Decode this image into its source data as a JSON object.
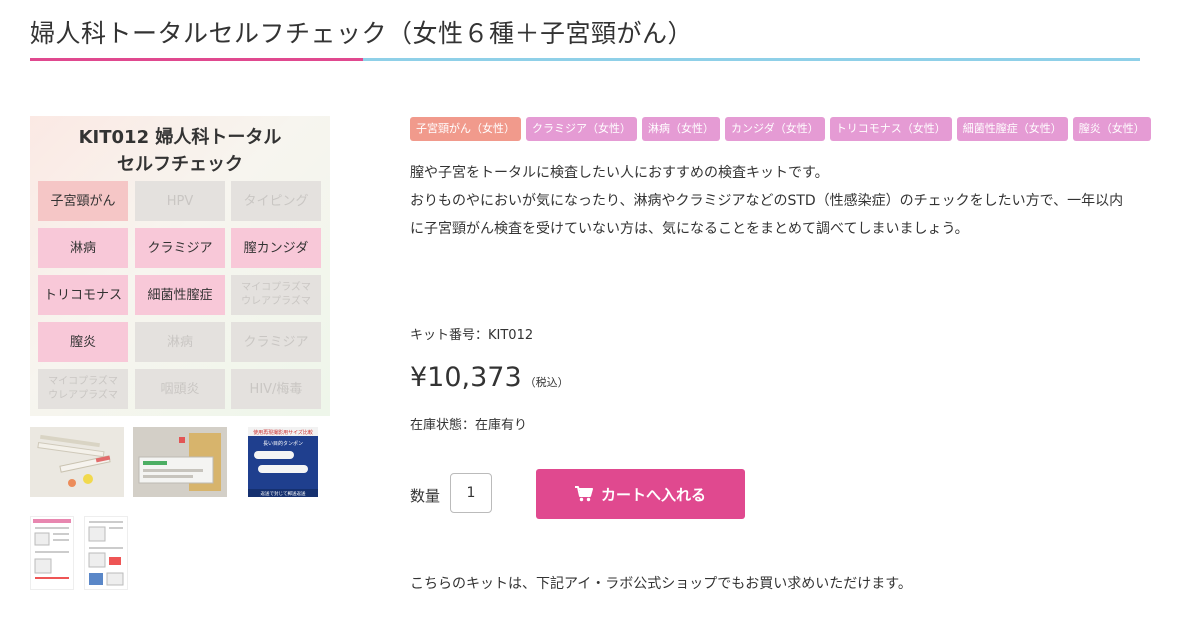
{
  "page_title": "婦人科トータルセルフチェック（女性６種＋子宮頸がん）",
  "main_image": {
    "heading_line1": "KIT012 婦人科トータル",
    "heading_line2": "セルフチェック",
    "grid": [
      [
        "子宮頸がん",
        "HPV",
        "タイピング"
      ],
      [
        "淋病",
        "クラミジア",
        "膣カンジダ"
      ],
      [
        "トリコモナス",
        "細菌性膣症",
        "マイコプラズマ\nウレアプラズマ"
      ],
      [
        "膣炎",
        "淋病",
        "クラミジア"
      ],
      [
        "マイコプラズマ\nウレアプラズマ",
        "咽頭炎",
        "HIV/梅毒"
      ]
    ]
  },
  "tags": [
    "子宮頸がん（女性）",
    "クラミジア（女性）",
    "淋病（女性）",
    "カンジダ（女性）",
    "トリコモナス（女性）",
    "細菌性膣症（女性）",
    "膣炎（女性）"
  ],
  "description": "膣や子宮をトータルに検査したい人におすすめの検査キットです。\nおりものやにおいが気になったり、淋病やクラミジアなどのSTD（性感染症）のチェックをしたい方で、一年以内に子宮頸がん検査を受けていない方は、気になることをまとめて調べてしまいましょう。",
  "kit_number": "キット番号：KIT012",
  "price": "¥10,373",
  "tax_note": "（税込）",
  "stock": "在庫状態：在庫有り",
  "quantity_label": "数量",
  "quantity_value": "1",
  "cart_button": "カートへ入れる",
  "thumbnails": {
    "thumb3_top_text": "使用再現撮影用サイズ比較",
    "thumb3_mid_text": "長い目的タンポン",
    "thumb3_bottom_text": "返送で封じて郵送返送"
  },
  "note": "こちらのキットは、下記アイ・ラボ公式ショップでもお買い求めいただけます。",
  "colors": {
    "accent": "#e0498f",
    "underline_blue": "#8fd0e8",
    "tag_first": "#f19a8c",
    "tag": "#e59bd4"
  }
}
